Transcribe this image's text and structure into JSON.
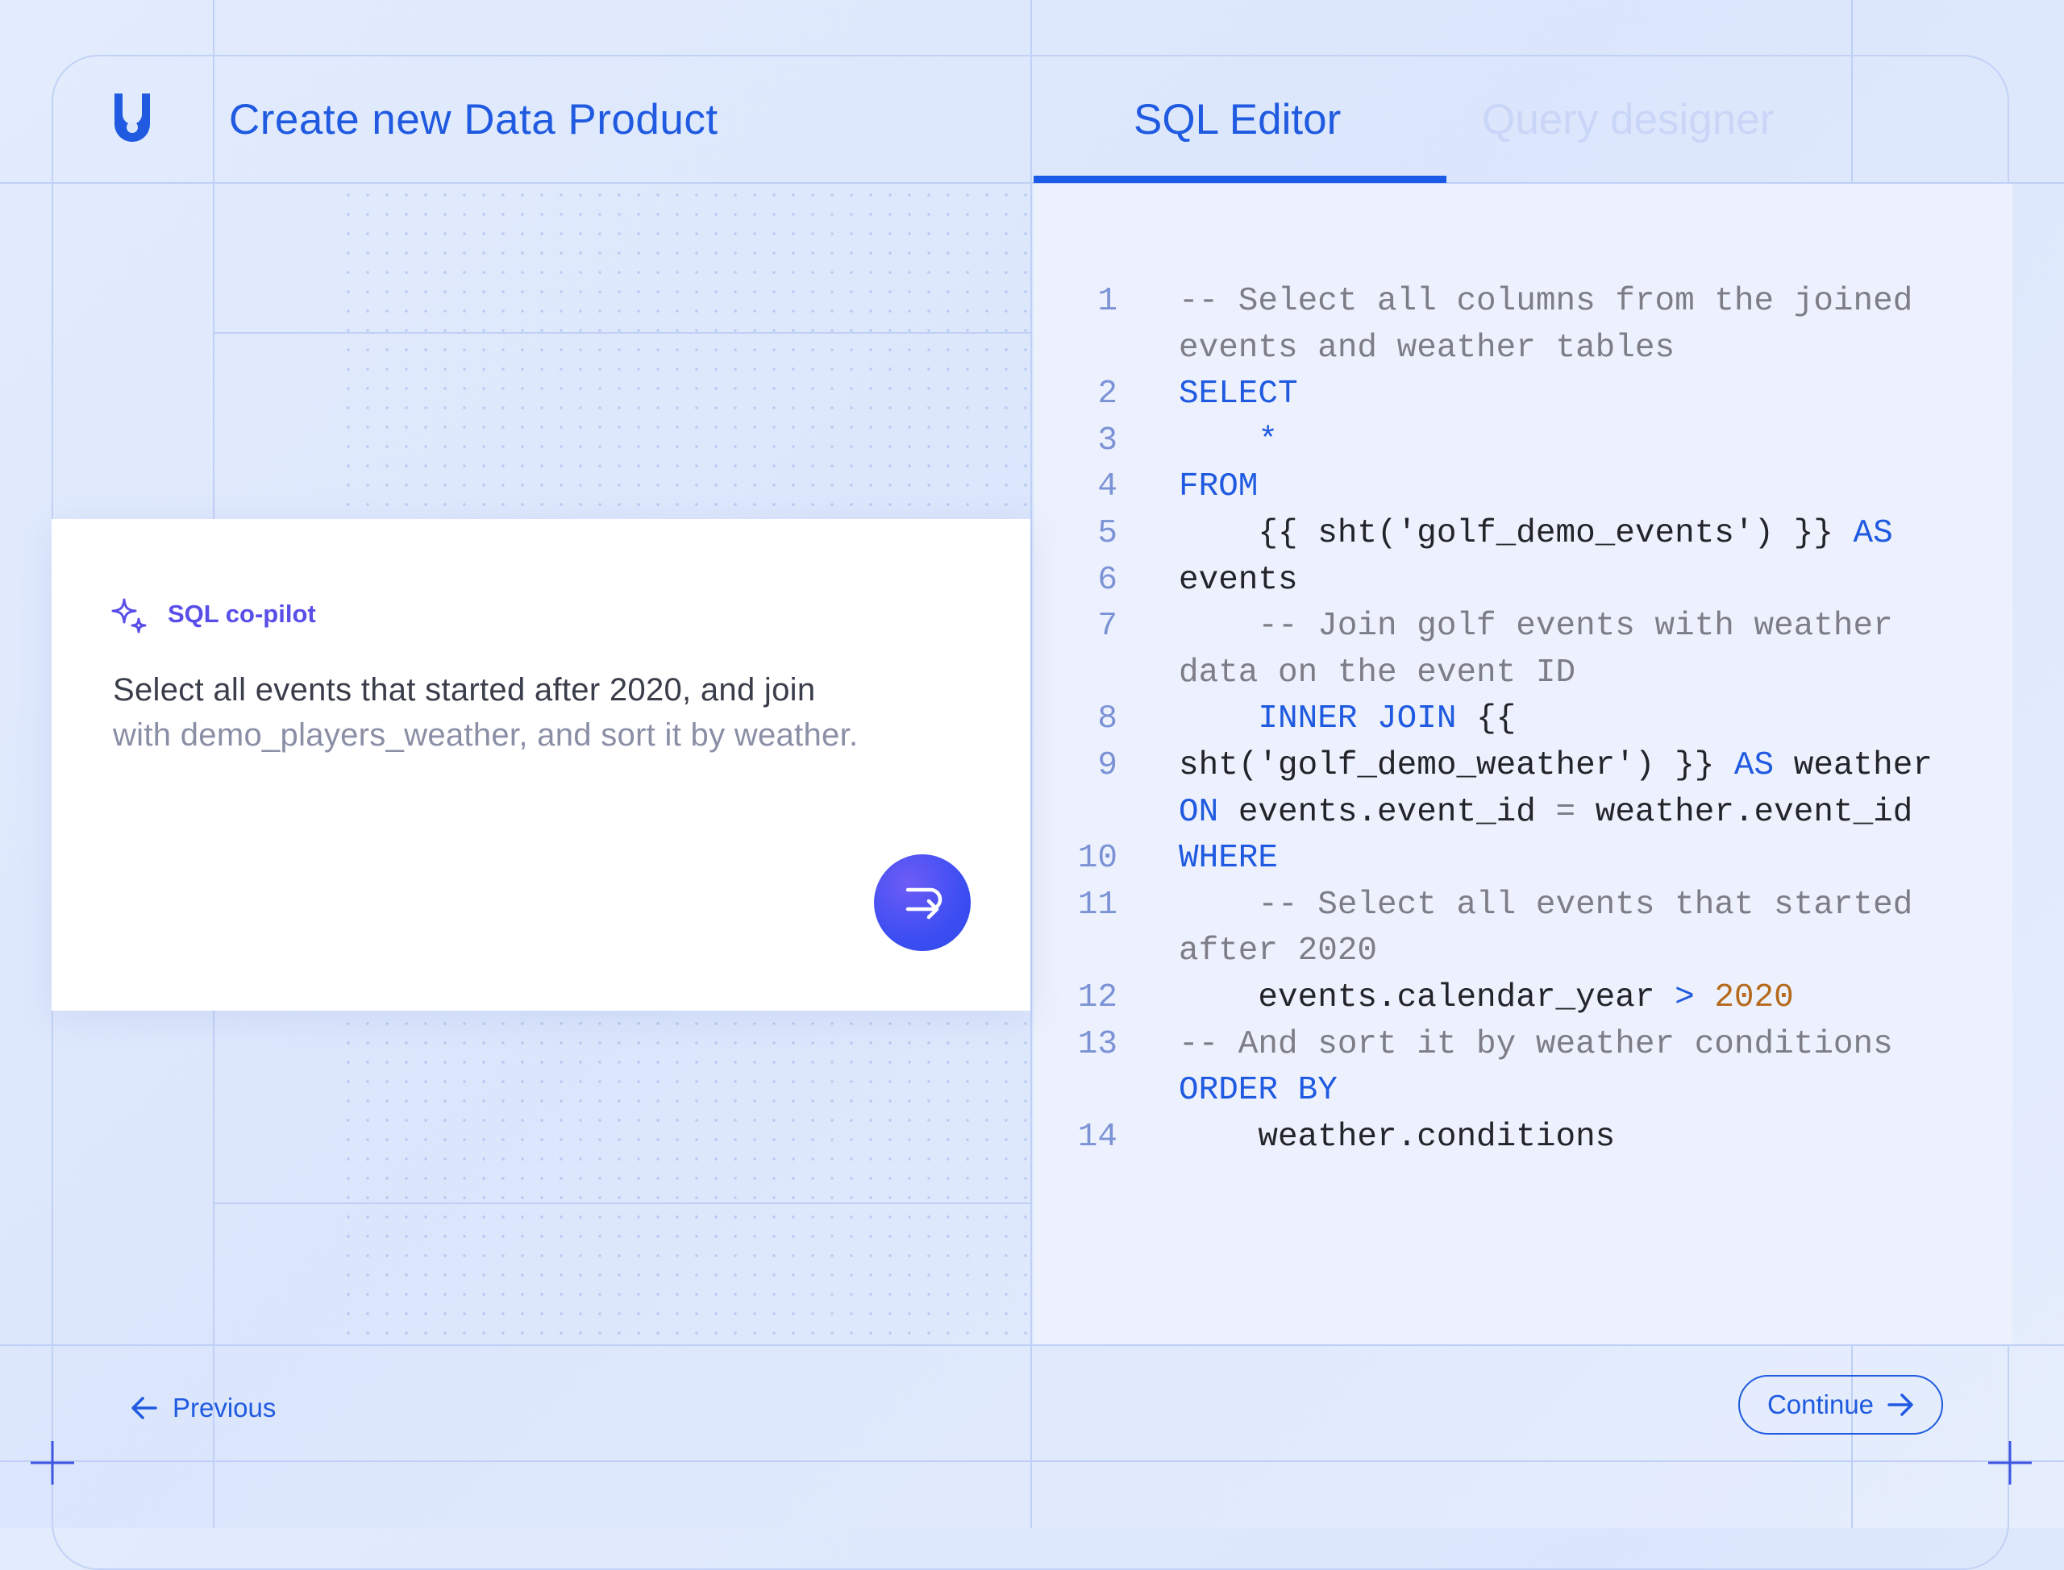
{
  "header": {
    "title": "Create new Data Product",
    "tabs": [
      {
        "label": "SQL Editor",
        "active": true
      },
      {
        "label": "Query designer",
        "active": false
      }
    ]
  },
  "editor": {
    "lines": [
      {
        "num": "1",
        "segments": [
          {
            "t": "-- Select all columns from the joined",
            "c": "cm"
          }
        ]
      },
      {
        "num": "",
        "segments": [
          {
            "t": "events and weather tables",
            "c": "cm"
          }
        ]
      },
      {
        "num": "2",
        "segments": [
          {
            "t": "SELECT",
            "c": "kw"
          }
        ]
      },
      {
        "num": "3",
        "segments": [
          {
            "t": "    *",
            "c": "kw"
          }
        ]
      },
      {
        "num": "4",
        "segments": [
          {
            "t": "FROM",
            "c": "kw"
          }
        ]
      },
      {
        "num": "5",
        "segments": [
          {
            "t": "    {{ sht('golf_demo_events') }} ",
            "c": "id"
          },
          {
            "t": "AS",
            "c": "kw"
          }
        ]
      },
      {
        "num": "6",
        "segments": [
          {
            "t": "events",
            "c": "id"
          }
        ]
      },
      {
        "num": "7",
        "segments": [
          {
            "t": "    -- Join golf events with weather",
            "c": "cm"
          }
        ]
      },
      {
        "num": "",
        "segments": [
          {
            "t": "data on the event ID",
            "c": "cm"
          }
        ]
      },
      {
        "num": "8",
        "segments": [
          {
            "t": "    INNER JOIN",
            "c": "kw"
          },
          {
            "t": " {{",
            "c": "id"
          }
        ]
      },
      {
        "num": "9",
        "segments": [
          {
            "t": "sht('golf_demo_weather') }} ",
            "c": "id"
          },
          {
            "t": "AS",
            "c": "kw"
          },
          {
            "t": " weather",
            "c": "id"
          }
        ]
      },
      {
        "num": "",
        "segments": [
          {
            "t": "ON",
            "c": "kw"
          },
          {
            "t": " events.event_id ",
            "c": "id"
          },
          {
            "t": "=",
            "c": "cm"
          },
          {
            "t": " weather.event_id",
            "c": "id"
          }
        ]
      },
      {
        "num": "10",
        "segments": [
          {
            "t": "WHERE",
            "c": "kw"
          }
        ]
      },
      {
        "num": "11",
        "segments": [
          {
            "t": "    -- Select all events that started",
            "c": "cm"
          }
        ]
      },
      {
        "num": "",
        "segments": [
          {
            "t": "after 2020",
            "c": "cm"
          }
        ]
      },
      {
        "num": "12",
        "segments": [
          {
            "t": "    events.calendar_year ",
            "c": "id"
          },
          {
            "t": ">",
            "c": "op"
          },
          {
            "t": " 2020",
            "c": "num"
          }
        ]
      },
      {
        "num": "13",
        "segments": [
          {
            "t": "-- And sort it by weather conditions",
            "c": "cm"
          }
        ]
      },
      {
        "num": "",
        "segments": [
          {
            "t": "ORDER BY",
            "c": "kw"
          }
        ]
      },
      {
        "num": "14",
        "segments": [
          {
            "t": "    weather.conditions",
            "c": "id"
          }
        ]
      }
    ]
  },
  "copilot": {
    "label": "SQL co-pilot",
    "prompt_line1": "Select all events that started after 2020, and join",
    "prompt_line2": "with demo_players_weather, and sort it by weather."
  },
  "footer": {
    "previous_label": "Previous",
    "continue_label": "Continue"
  },
  "colors": {
    "accent": "#1f5ae0",
    "copilot_accent": "#5a4ee8",
    "keyword": "#1f5ae0",
    "comment": "#7d7d87",
    "number": "#b56a1d"
  }
}
